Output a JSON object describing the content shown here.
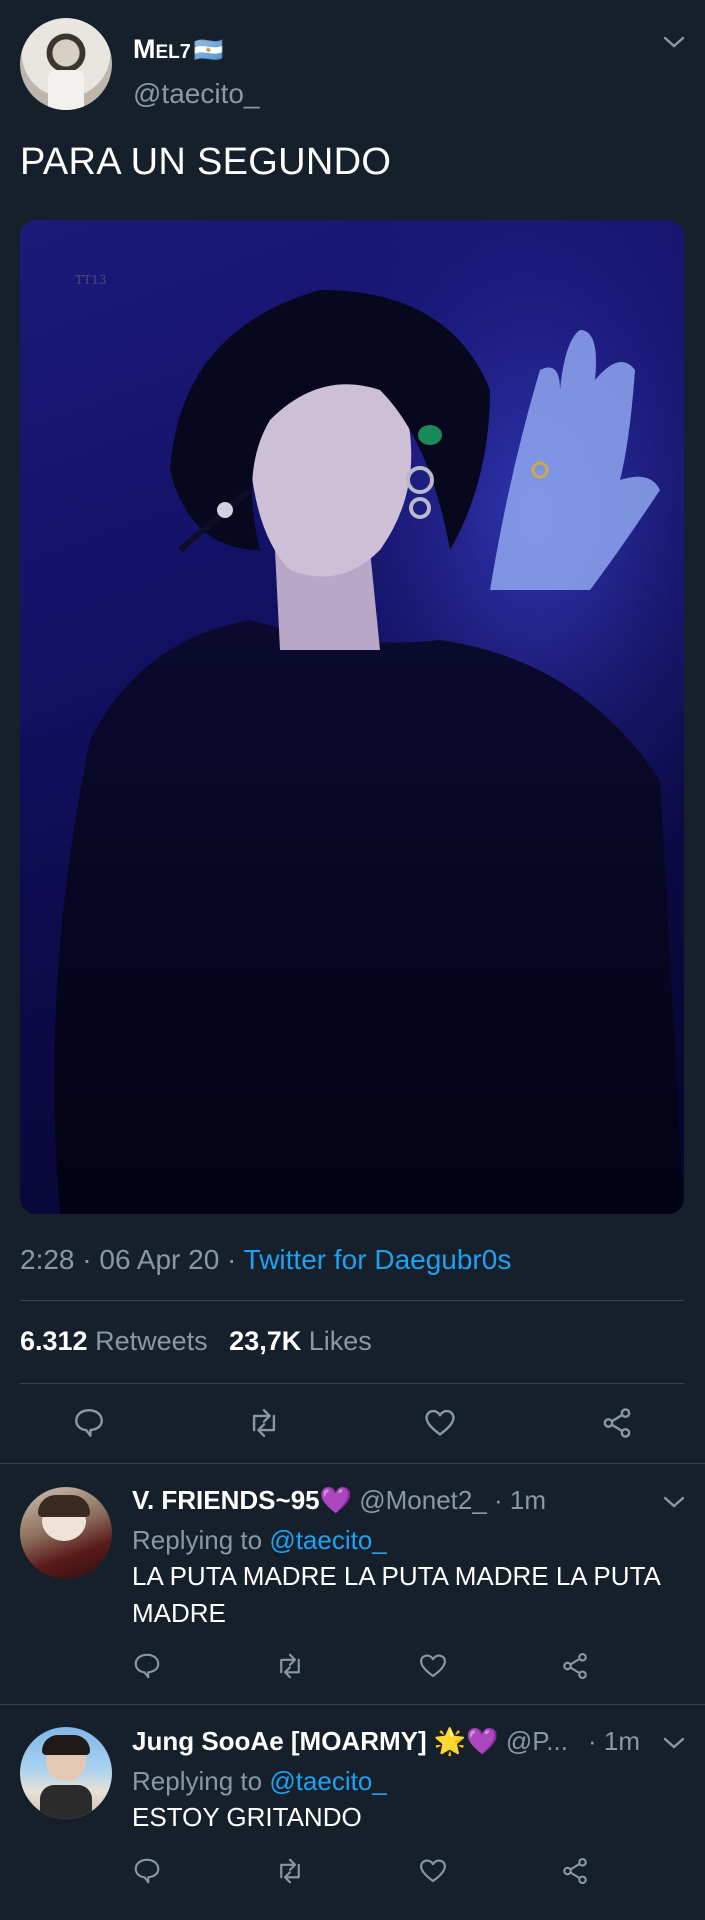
{
  "tweet": {
    "display_name": "Mel",
    "name_suffix": "7",
    "flag": "🇦🇷",
    "handle": "@taecito_",
    "text": "PARA UN SEGUNDO",
    "image_watermark": "TT13",
    "time": "2:28",
    "date": "06 Apr 20",
    "sep": "·",
    "source": "Twitter for Daegubr0s",
    "retweets_count": "6.312",
    "retweets_label": "Retweets",
    "likes_count": "23,7K",
    "likes_label": "Likes"
  },
  "replies": [
    {
      "name": "V. FRIENDS~95",
      "emoji": "💜",
      "handle": "@Monet2_",
      "time": "· 1m",
      "replying_label": "Replying to",
      "replying_to": "@taecito_",
      "text": "LA PUTA MADRE LA PUTA MADRE LA PUTA MADRE"
    },
    {
      "name": "Jung SooAe [MOARMY]",
      "emoji": "🌟💜",
      "handle": "@P...",
      "time": "· 1m",
      "replying_label": "Replying to",
      "replying_to": "@taecito_",
      "text": "ESTOY GRITANDO"
    }
  ],
  "colors": {
    "background": "#15202b",
    "muted": "#8899a6",
    "link": "#1da1f2",
    "divider": "#38444d"
  },
  "icons": [
    "chevron-down-icon",
    "reply-icon",
    "retweet-icon",
    "like-icon",
    "share-icon"
  ]
}
